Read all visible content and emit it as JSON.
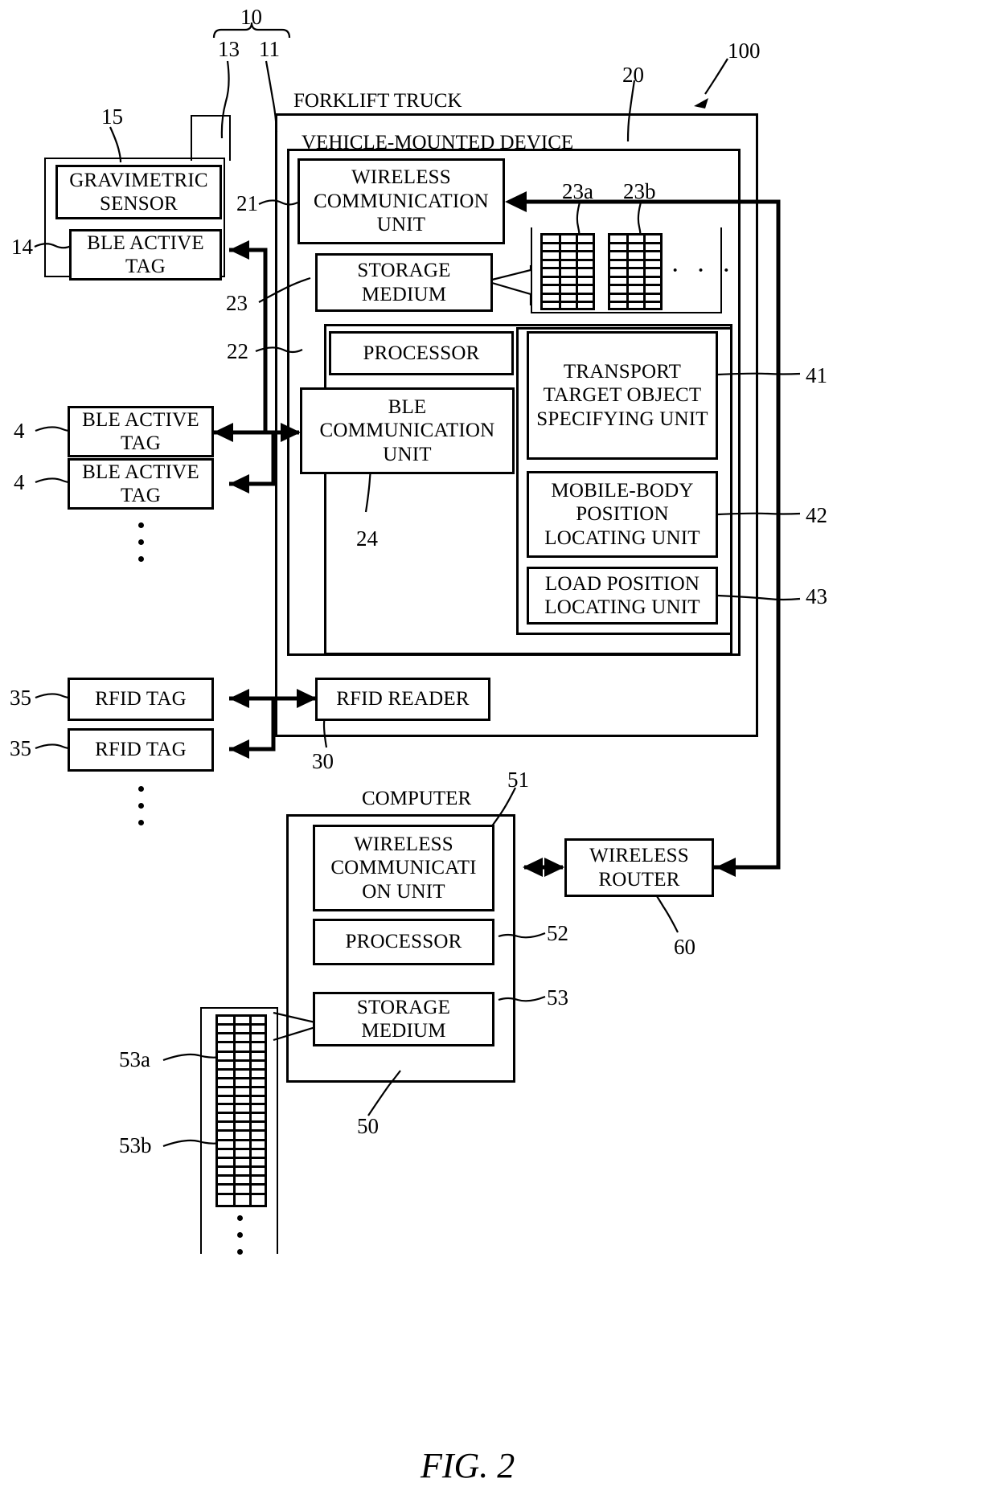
{
  "figure": {
    "caption": "FIG. 2",
    "system_ref": "100"
  },
  "forklift": {
    "title": "FORKLIFT TRUCK",
    "ref": "11",
    "group_ref": "10",
    "pallet_ref": "13",
    "device": {
      "title": "VEHICLE-MOUNTED DEVICE",
      "ref": "20",
      "wireless_communication_unit": {
        "label": "WIRELESS COMMUNICATION UNIT",
        "ref": "21"
      },
      "storage_medium": {
        "label": "STORAGE MEDIUM",
        "ref": "23"
      },
      "processor": {
        "label": "PROCESSOR",
        "ref": "22"
      },
      "ble_communication_unit": {
        "label": "BLE COMMUNICATION UNIT",
        "ref": "24"
      },
      "tables": [
        {
          "ref": "23a",
          "icon": "table-icon"
        },
        {
          "ref": "23b",
          "icon": "table-icon"
        }
      ],
      "tables_more": "· · ·",
      "functions": [
        {
          "label": "TRANSPORT TARGET OBJECT SPECIFYING UNIT",
          "ref": "41"
        },
        {
          "label": "MOBILE-BODY POSITION LOCATING UNIT",
          "ref": "42"
        },
        {
          "label": "LOAD POSITION LOCATING UNIT",
          "ref": "43"
        }
      ]
    },
    "rfid_reader": {
      "label": "RFID READER",
      "ref": "30"
    }
  },
  "pallet": {
    "gravimetric_sensor": {
      "label": "GRAVIMETRIC SENSOR",
      "ref": "15"
    },
    "ble_active_tag": {
      "label": "BLE ACTIVE TAG",
      "ref": "14"
    }
  },
  "ble_tags": [
    {
      "label": "BLE ACTIVE TAG",
      "ref": "4"
    },
    {
      "label": "BLE ACTIVE TAG",
      "ref": "4"
    }
  ],
  "ble_tags_more": "vertical-ellipsis",
  "rfid_tags": [
    {
      "label": "RFID TAG",
      "ref": "35"
    },
    {
      "label": "RFID TAG",
      "ref": "35"
    }
  ],
  "rfid_tags_more": "vertical-ellipsis",
  "computer": {
    "title": "COMPUTER",
    "ref": "50",
    "wireless_communication_unit": {
      "label": "WIRELESS COMMUNICATI ON UNIT",
      "ref": "51"
    },
    "processor": {
      "label": "PROCESSOR",
      "ref": "52"
    },
    "storage_medium": {
      "label": "STORAGE MEDIUM",
      "ref": "53"
    },
    "tables": [
      {
        "ref": "53a",
        "icon": "table-icon"
      },
      {
        "ref": "53b",
        "icon": "table-icon"
      }
    ],
    "tables_more": "vertical-ellipsis"
  },
  "wireless_router": {
    "label": "WIRELESS ROUTER",
    "ref": "60"
  }
}
